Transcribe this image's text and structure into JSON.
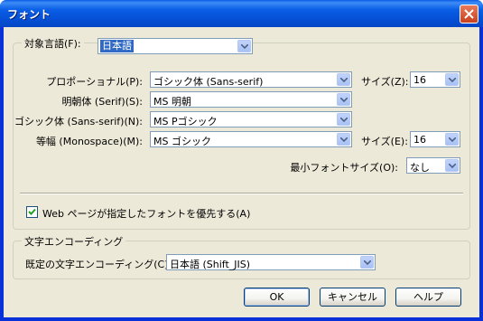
{
  "window": {
    "title": "フォント"
  },
  "language": {
    "label": "対象言語(F):",
    "value": "日本語"
  },
  "fonts": {
    "proportional": {
      "label": "プロポーショナル(P):",
      "value": "ゴシック体 (Sans-serif)"
    },
    "size_label": "サイズ(Z):",
    "size_value": "16",
    "serif": {
      "label": "明朝体 (Serif)(S):",
      "value": "MS 明朝"
    },
    "sans": {
      "label": "ゴシック体 (Sans-serif)(N):",
      "value": "MS Pゴシック"
    },
    "monospace": {
      "label": "等幅 (Monospace)(M):",
      "value": "MS ゴシック"
    },
    "mono_size_label": "サイズ(E):",
    "mono_size_value": "16",
    "min_size_label": "最小フォントサイズ(O):",
    "min_size_value": "なし",
    "allow_page_fonts_label": "Web ページが指定したフォントを優先する(A)",
    "allow_page_fonts_checked": true
  },
  "encoding": {
    "group_label": "文字エンコーディング",
    "default_label": "既定の文字エンコーディング(C):",
    "default_value": "日本語 (Shift_JIS)"
  },
  "buttons": {
    "ok": "OK",
    "cancel": "キャンセル",
    "help": "ヘルプ"
  }
}
